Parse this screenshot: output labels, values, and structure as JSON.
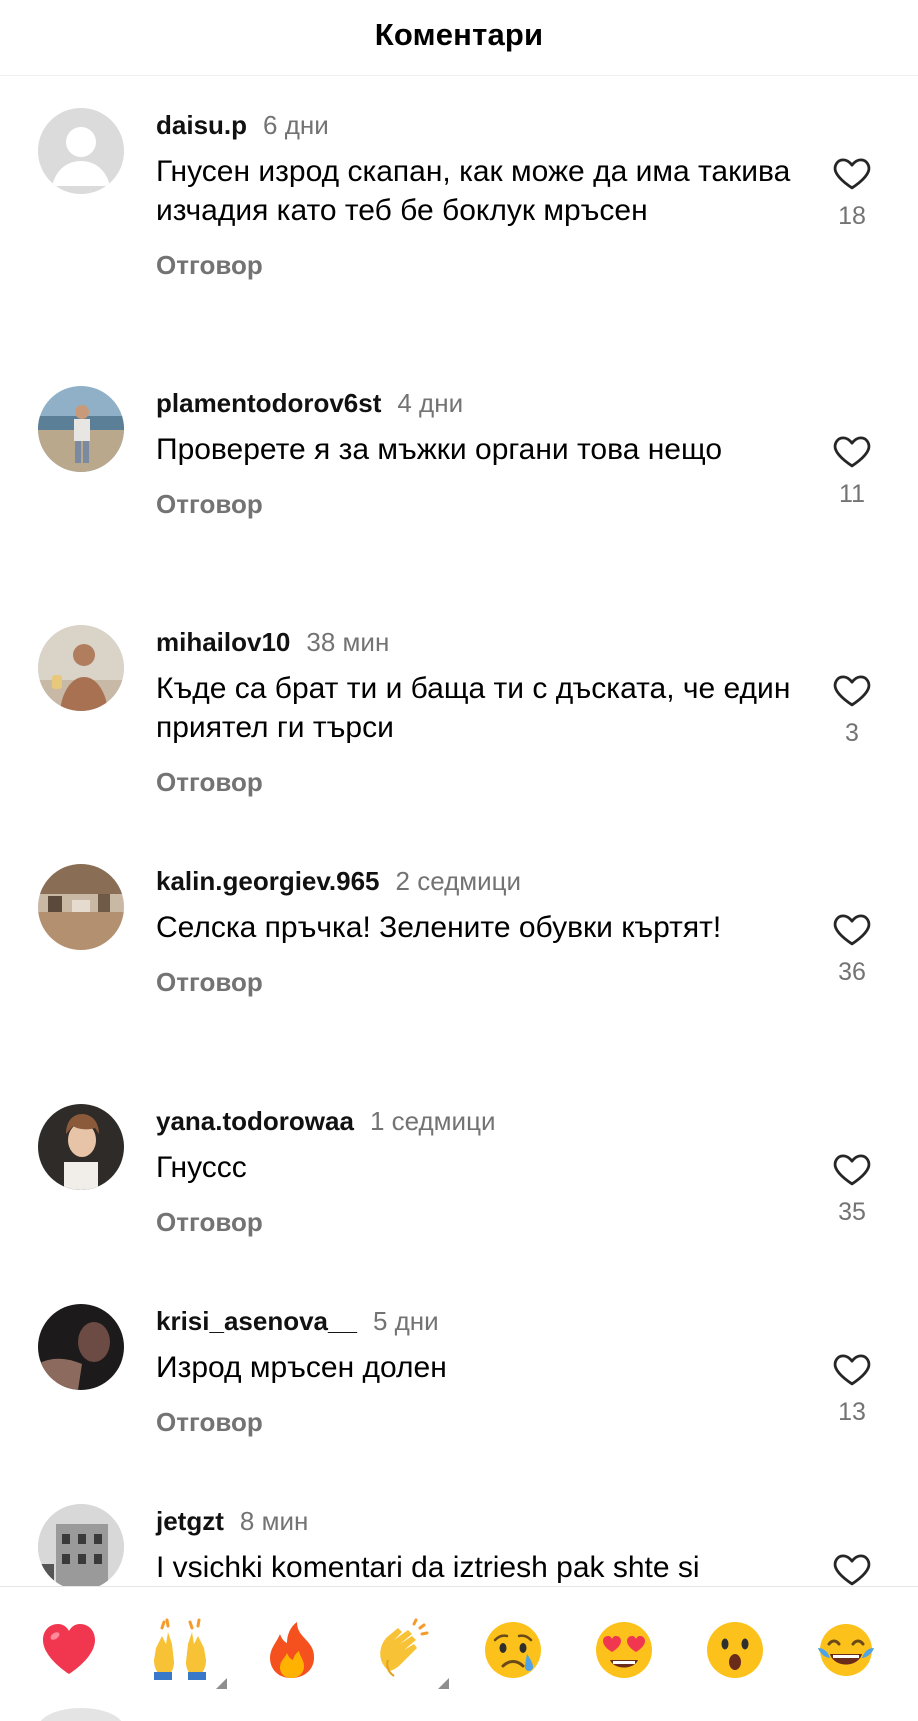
{
  "header": {
    "title": "Коментари"
  },
  "comments": [
    {
      "username": "daisu.p",
      "time": "6 дни",
      "text": "Гнусен изрод скапан, как може да има такива изчадия като теб бе боклук мръсен",
      "reply": "Отговор",
      "likes": "18",
      "avatar": "default-avatar"
    },
    {
      "username": "plamentodorov6st",
      "time": "4 дни",
      "text": "Проверете я за мъжки органи това нещо",
      "reply": "Отговор",
      "likes": "11",
      "avatar": "photo-man-seaside"
    },
    {
      "username": "mihailov10",
      "time": "38 мин",
      "text": "Къде са брат ти и баща ти с дъската, че един приятел ги търси",
      "reply": "Отговор",
      "likes": "3",
      "avatar": "photo-man-shirtless"
    },
    {
      "username": "kalin.georgiev.965",
      "time": "2 седмици",
      "text": "Селска пръчка! Зелените обувки къртят!",
      "reply": "Отговор",
      "likes": "36",
      "avatar": "photo-beach"
    },
    {
      "username": "yana.todorowaa",
      "time": "1 седмици",
      "text": "Гнуссс",
      "reply": "Отговор",
      "likes": "35",
      "avatar": "photo-woman"
    },
    {
      "username": "krisi_asenova__",
      "time": "5 дни",
      "text": "Изрод мръсен долен",
      "reply": "Отговор",
      "likes": "13",
      "avatar": "photo-dark"
    },
    {
      "username": "jetgzt",
      "time": "8 мин",
      "text": "I vsichki komentari da iztriesh pak shte si",
      "reply": "",
      "likes": "",
      "avatar": "photo-building"
    }
  ],
  "emoji_bar": [
    {
      "name": "red-heart-emoji",
      "label": "❤️"
    },
    {
      "name": "raising-hands-emoji",
      "label": "🙌"
    },
    {
      "name": "fire-emoji",
      "label": "🔥"
    },
    {
      "name": "clapping-hands-emoji",
      "label": "👏"
    },
    {
      "name": "crying-face-emoji",
      "label": "😢"
    },
    {
      "name": "heart-eyes-emoji",
      "label": "😍"
    },
    {
      "name": "surprised-face-emoji",
      "label": "😮"
    },
    {
      "name": "tears-of-joy-emoji",
      "label": "😂"
    }
  ],
  "colors": {
    "secondary_text": "#737373",
    "like_outline": "#262626",
    "divider": "#efefef"
  },
  "icons": {
    "like": "heart-outline-icon"
  }
}
